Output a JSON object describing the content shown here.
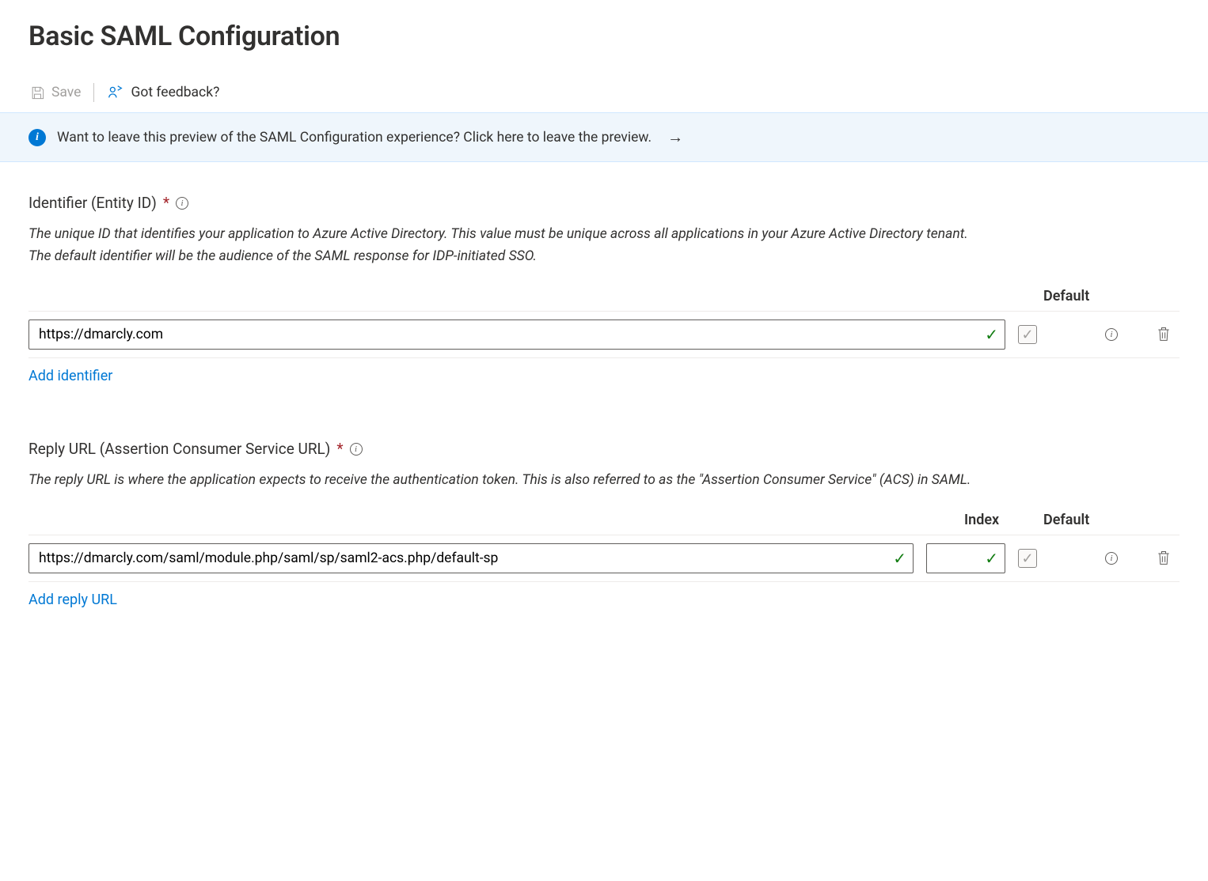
{
  "title": "Basic SAML Configuration",
  "toolbar": {
    "save_label": "Save",
    "feedback_label": "Got feedback?"
  },
  "banner": {
    "text": "Want to leave this preview of the SAML Configuration experience? Click here to leave the preview."
  },
  "columns": {
    "index": "Index",
    "default": "Default"
  },
  "identifier": {
    "label": "Identifier (Entity ID)",
    "required_mark": "*",
    "description": "The unique ID that identifies your application to Azure Active Directory. This value must be unique across all applications in your Azure Active Directory tenant. The default identifier will be the audience of the SAML response for IDP-initiated SSO.",
    "rows": [
      {
        "value": "https://dmarcly.com"
      }
    ],
    "add_label": "Add identifier"
  },
  "reply_url": {
    "label": "Reply URL (Assertion Consumer Service URL)",
    "required_mark": "*",
    "description": "The reply URL is where the application expects to receive the authentication token. This is also referred to as the \"Assertion Consumer Service\" (ACS) in SAML.",
    "rows": [
      {
        "value": "https://dmarcly.com/saml/module.php/saml/sp/saml2-acs.php/default-sp",
        "index": ""
      }
    ],
    "add_label": "Add reply URL"
  }
}
